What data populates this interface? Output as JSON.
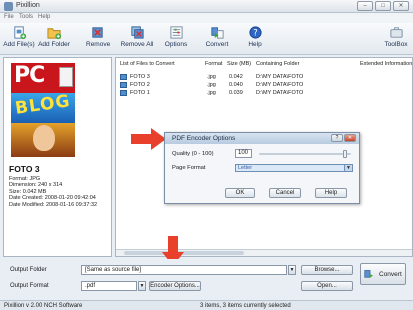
{
  "window": {
    "title": "Pixillion",
    "buttons": [
      "–",
      "□",
      "✕"
    ]
  },
  "menu": [
    "File",
    "Tools",
    "Help"
  ],
  "toolbar": {
    "items": [
      {
        "label": "Add File(s)",
        "icon": "add-file-icon"
      },
      {
        "label": "Add Folder",
        "icon": "add-folder-icon"
      },
      {
        "label": "Remove",
        "icon": "remove-icon"
      },
      {
        "label": "Remove All",
        "icon": "remove-all-icon"
      },
      {
        "label": "Options",
        "icon": "options-icon"
      },
      {
        "label": "Convert",
        "icon": "convert-icon"
      },
      {
        "label": "Help",
        "icon": "help-icon"
      }
    ],
    "right_item": {
      "label": "ToolBox",
      "icon": "toolbox-icon"
    }
  },
  "file_list": {
    "columns": [
      "List of Files to Convert",
      "Format",
      "Size (MB)",
      "Containing Folder",
      "Extended Information"
    ],
    "rows": [
      {
        "name": "FOTO 3",
        "format": ".jpg",
        "size": "0.042",
        "folder": "D:\\MY DATA\\FOTO"
      },
      {
        "name": "FOTO 2",
        "format": ".jpg",
        "size": "0.040",
        "folder": "D:\\MY DATA\\FOTO"
      },
      {
        "name": "FOTO 1",
        "format": ".jpg",
        "size": "0.039",
        "folder": "D:\\MY DATA\\FOTO"
      }
    ]
  },
  "preview": {
    "cover_title": "PC",
    "cover_headline": "BLOG",
    "info_title": "FOTO 3",
    "info_lines": [
      "Format: JPG",
      "Dimension: 240 x 314",
      "Size: 0.042 MB",
      "Date Created: 2008-01-20 09:42:04",
      "Date Modified: 2008-01-16 09:37:32"
    ]
  },
  "dialog": {
    "title": "PDF Encoder Options",
    "quality_label": "Quality (0 - 100)",
    "quality_value": "100",
    "page_format_label": "Page Format",
    "page_format_value": "Letter",
    "ok": "OK",
    "cancel": "Cancel",
    "help": "Help"
  },
  "bottom": {
    "output_folder_label": "Output Folder",
    "output_folder_value": "[Same as source file]",
    "output_format_label": "Output Format",
    "output_format_value": ".pdf",
    "encoder_options": "Encoder Options...",
    "browse": "Browse...",
    "open": "Open...",
    "convert": "Convert"
  },
  "status": {
    "left": "Pixillion v 2.00  NCH Software",
    "center": "3 items, 3 items currently selected"
  },
  "colors": {
    "accent_arrow": "#e8402a",
    "select_highlight": "#dbe8f7"
  }
}
